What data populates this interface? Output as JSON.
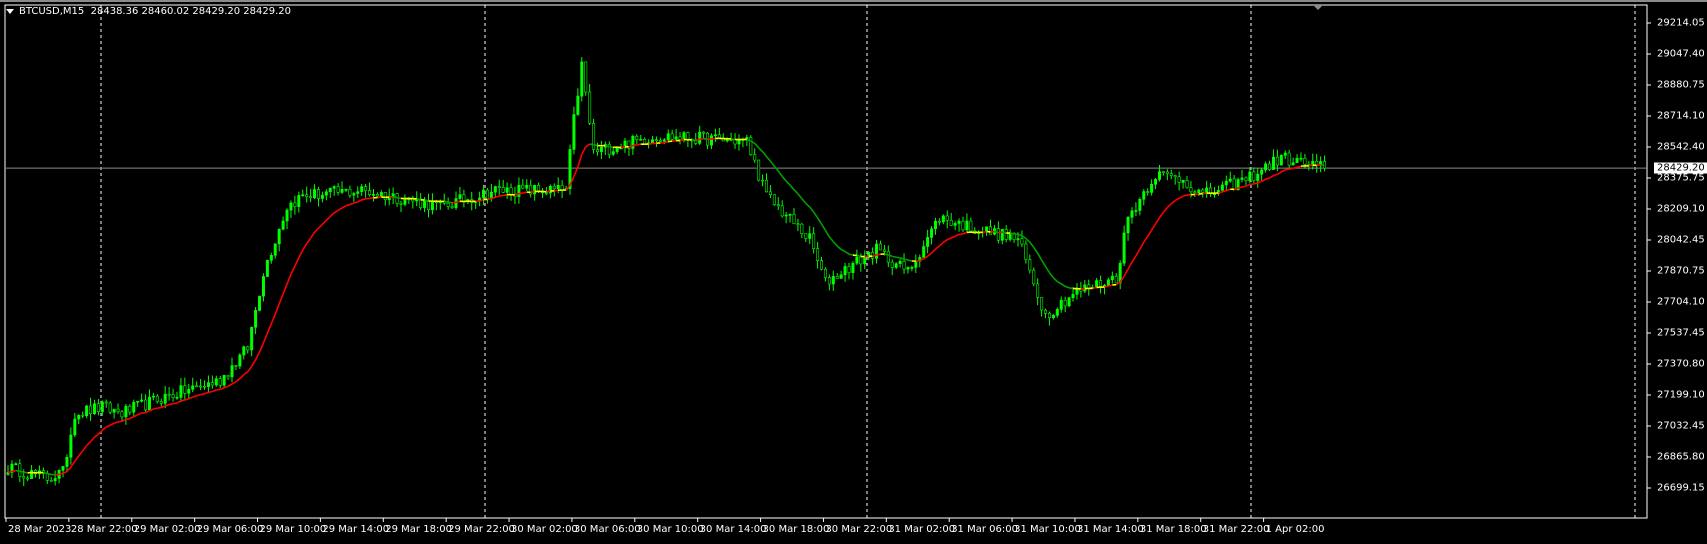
{
  "header": {
    "symbol": "BTCUSD,M15",
    "ohlc": "28438.36 28460.02 28429.20 28429.20"
  },
  "current_price": "28429.20",
  "colors": {
    "background": "#000000",
    "bull": "#00ff00",
    "bear": "#00ff00",
    "ma_up": "#ff0000",
    "ma_down": "#00a000",
    "ma_flat": "#ffff00",
    "grid": "#ffffff",
    "bid_line": "#8a8a8a"
  },
  "chart_data": {
    "type": "candlestick",
    "title": "BTCUSD,M15",
    "ylim": [
      26699.15,
      29214.05
    ],
    "y_ticks": [
      "29214.05",
      "29047.40",
      "28880.75",
      "28714.10",
      "28542.40",
      "28375.75",
      "28209.10",
      "28042.45",
      "27870.75",
      "27704.10",
      "27537.45",
      "27370.80",
      "27199.10",
      "27032.45",
      "26865.80",
      "26699.15"
    ],
    "x_ticks": [
      "28 Mar 2023",
      "28 Mar 22:00",
      "29 Mar 02:00",
      "29 Mar 06:00",
      "29 Mar 10:00",
      "29 Mar 14:00",
      "29 Mar 18:00",
      "29 Mar 22:00",
      "30 Mar 02:00",
      "30 Mar 06:00",
      "30 Mar 10:00",
      "30 Mar 14:00",
      "30 Mar 18:00",
      "30 Mar 22:00",
      "31 Mar 02:00",
      "31 Mar 06:00",
      "31 Mar 10:00",
      "31 Mar 14:00",
      "31 Mar 18:00",
      "31 Mar 22:00",
      "1 Apr 02:00"
    ],
    "bars_per_tick": 16,
    "close_keypoints": [
      [
        0,
        26811
      ],
      [
        10,
        26752
      ],
      [
        14,
        26782
      ],
      [
        17,
        27105
      ],
      [
        24,
        27134
      ],
      [
        29,
        27105
      ],
      [
        40,
        27193
      ],
      [
        54,
        27281
      ],
      [
        61,
        27457
      ],
      [
        65,
        27868
      ],
      [
        71,
        28221
      ],
      [
        75,
        28280
      ],
      [
        90,
        28309
      ],
      [
        104,
        28250
      ],
      [
        110,
        28221
      ],
      [
        124,
        28309
      ],
      [
        142,
        28309
      ],
      [
        144,
        28691
      ],
      [
        146,
        28985
      ],
      [
        149,
        28515
      ],
      [
        154,
        28544
      ],
      [
        165,
        28603
      ],
      [
        188,
        28574
      ],
      [
        193,
        28280
      ],
      [
        204,
        28045
      ],
      [
        208,
        27810
      ],
      [
        212,
        27868
      ],
      [
        221,
        27986
      ],
      [
        229,
        27868
      ],
      [
        237,
        28162
      ],
      [
        246,
        28104
      ],
      [
        257,
        28045
      ],
      [
        264,
        27634
      ],
      [
        271,
        27751
      ],
      [
        282,
        27839
      ],
      [
        285,
        28162
      ],
      [
        292,
        28397
      ],
      [
        299,
        28368
      ],
      [
        304,
        28280
      ],
      [
        315,
        28368
      ],
      [
        324,
        28486
      ],
      [
        335,
        28429
      ]
    ]
  }
}
